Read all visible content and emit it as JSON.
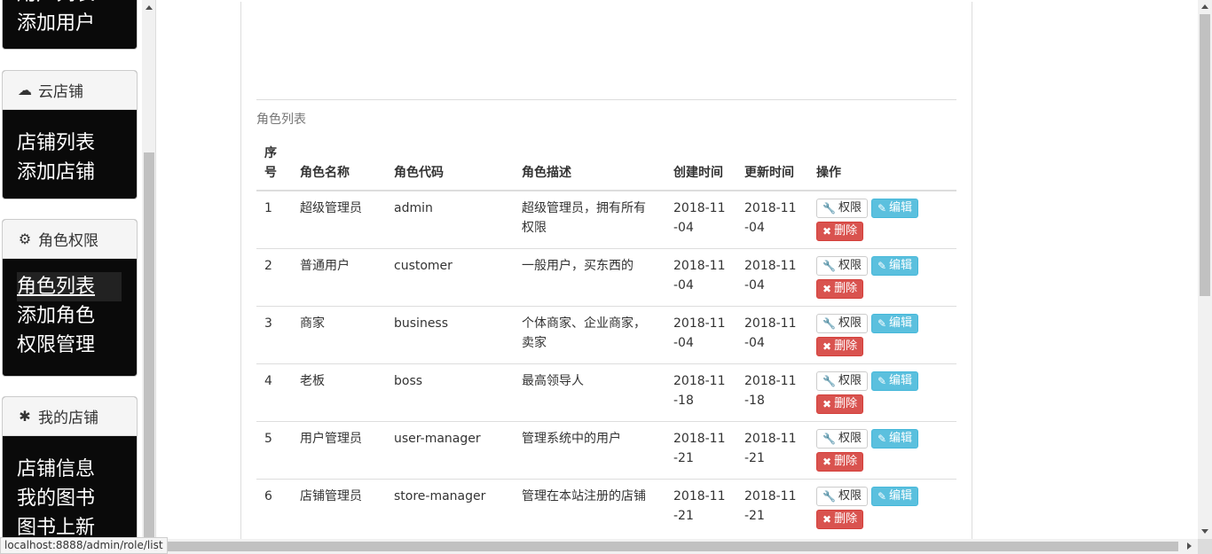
{
  "sidebar": {
    "panel_user": {
      "links": [
        "用户列表",
        "添加用户"
      ]
    },
    "panel_shop": {
      "title": "云店铺",
      "icon": "cloud-icon",
      "links": [
        "店铺列表",
        "添加店铺"
      ]
    },
    "panel_role": {
      "title": "角色权限",
      "icon": "gear-icon",
      "links": [
        "角色列表",
        "添加角色",
        "权限管理"
      ]
    },
    "panel_myshop": {
      "title": "我的店铺",
      "icon": "asterisk-icon",
      "links": [
        "店铺信息",
        "我的图书",
        "图书上新"
      ]
    }
  },
  "main": {
    "caption": "角色列表",
    "headers": [
      "序号",
      "角色名称",
      "角色代码",
      "角色描述",
      "创建时间",
      "更新时间",
      "操作"
    ],
    "buttons": {
      "perm": "权限",
      "edit": "编辑",
      "delete": "删除"
    },
    "rows": [
      {
        "no": "1",
        "name": "超级管理员",
        "code": "admin",
        "desc": "超级管理员，拥有所有权限",
        "created": "2018-11-04",
        "updated": "2018-11-04"
      },
      {
        "no": "2",
        "name": "普通用户",
        "code": "customer",
        "desc": "一般用户，买东西的",
        "created": "2018-11-04",
        "updated": "2018-11-04"
      },
      {
        "no": "3",
        "name": "商家",
        "code": "business",
        "desc": "个体商家、企业商家，卖家",
        "created": "2018-11-04",
        "updated": "2018-11-04"
      },
      {
        "no": "4",
        "name": "老板",
        "code": "boss",
        "desc": "最高领导人",
        "created": "2018-11-18",
        "updated": "2018-11-18"
      },
      {
        "no": "5",
        "name": "用户管理员",
        "code": "user-manager",
        "desc": "管理系统中的用户",
        "created": "2018-11-21",
        "updated": "2018-11-21"
      },
      {
        "no": "6",
        "name": "店铺管理员",
        "code": "store-manager",
        "desc": "管理在本站注册的店铺",
        "created": "2018-11-21",
        "updated": "2018-11-21"
      }
    ]
  },
  "status_bar": {
    "url": "localhost:8888/admin/role/list"
  }
}
